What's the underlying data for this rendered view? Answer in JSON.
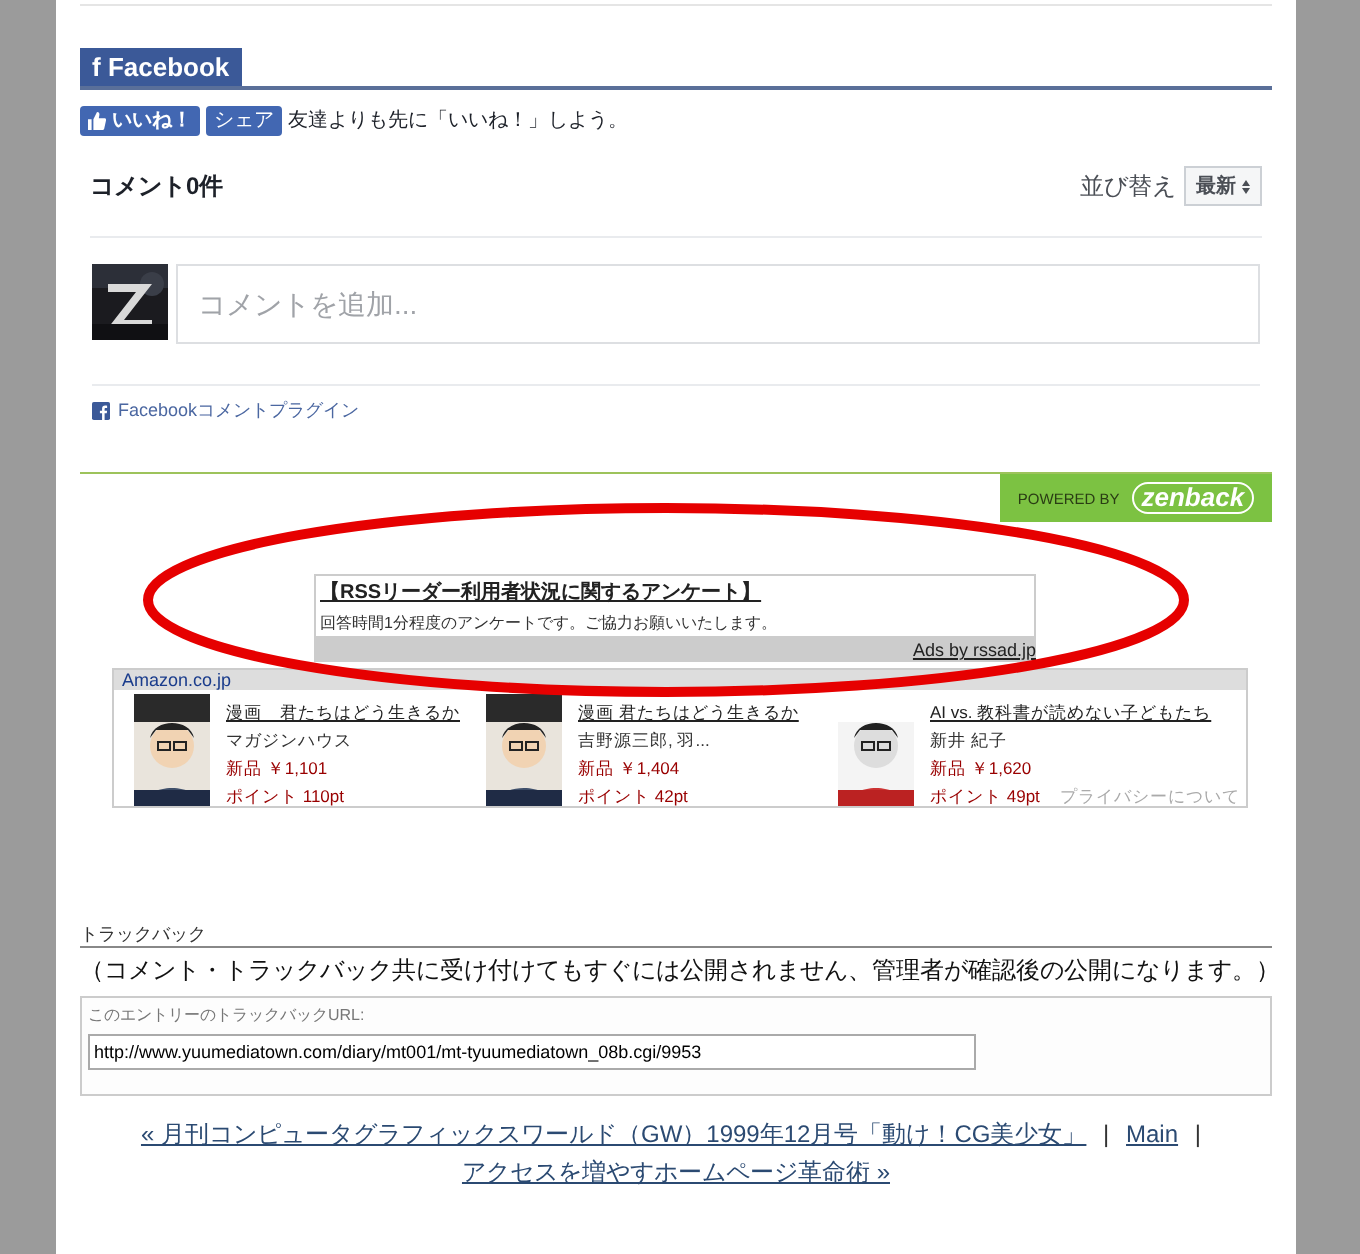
{
  "facebook_section": {
    "tab": "f Facebook",
    "like_button": "いいね！",
    "share_button": "シェア",
    "like_prompt": "友達よりも先に「いいね！」しよう。"
  },
  "comments": {
    "count": "コメント0件",
    "sort_label": "並び替え",
    "sort_value": "最新",
    "placeholder": "コメントを追加...",
    "plugin_link": "Facebookコメントプラグイン"
  },
  "zenback": {
    "powered_by": "POWERED BY",
    "brand": "zenback"
  },
  "survey_ad": {
    "title": "【RSSリーダー利用者状況に関するアンケート】",
    "text": "回答時間1分程度のアンケートです。ご協力お願いいたします。",
    "credit": "Ads by rssad.jp"
  },
  "amazon": {
    "header": "Amazon.co.jp",
    "privacy": "プライバシーについて",
    "items": [
      {
        "title": "漫画　君たちはどう生きるか",
        "author": "マガジンハウス",
        "price": "新品 ￥1,101",
        "points": "ポイント 110pt"
      },
      {
        "title": "漫画 君たちはどう生きるか",
        "author": "吉野源三郎, 羽...",
        "price": "新品 ￥1,404",
        "points": "ポイント 42pt"
      },
      {
        "title": "AI vs. 教科書が読めない子どもたち",
        "author": "新井 紀子",
        "price": "新品 ￥1,620",
        "points": "ポイント 49pt"
      }
    ]
  },
  "trackback": {
    "heading": "トラックバック",
    "notice": "（コメント・トラックバック共に受け付けてもすぐには公開されません、管理者が確認後の公開になります。）",
    "url_label": "このエントリーのトラックバックURL:",
    "url": "http://www.yuumediatown.com/diary/mt001/mt-tyuumediatown_08b.cgi/9953"
  },
  "navigation": {
    "previous": "« 月刊コンピュータグラフィックスワールド（GW）1999年12月号「動け！CG美少女」",
    "separator_1": "|",
    "main": "Main",
    "separator_2": "|",
    "next": "アクセスを増やすホームページ革命術 »"
  }
}
